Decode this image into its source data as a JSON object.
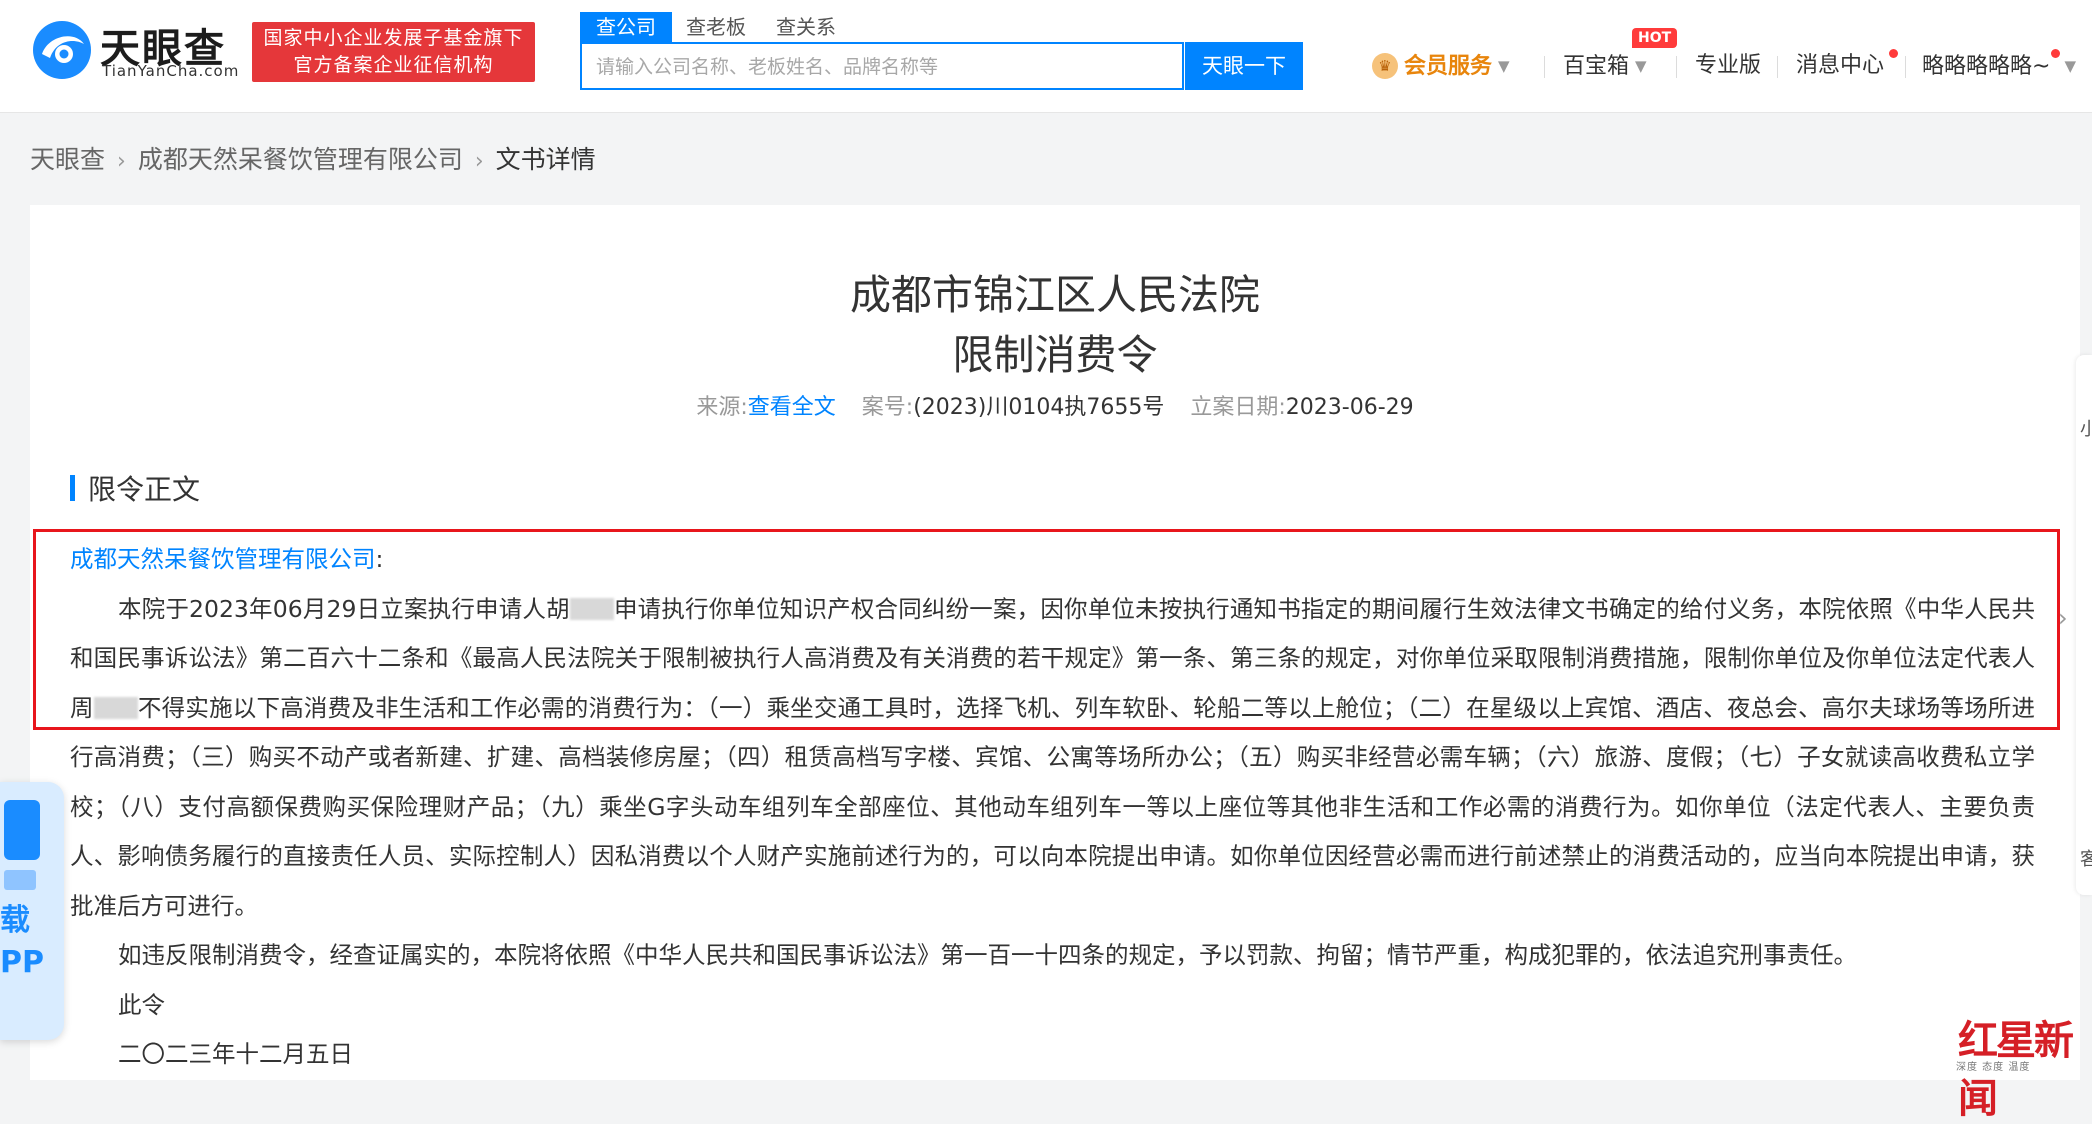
{
  "header": {
    "logo_cn": "天眼查",
    "logo_en": "TianYanCha.com",
    "gov_badge_line1": "国家中小企业发展子基金旗下",
    "gov_badge_line2": "官方备案企业征信机构",
    "search_tabs": [
      "查公司",
      "查老板",
      "查关系"
    ],
    "search_placeholder": "请输入公司名称、老板姓名、品牌名称等",
    "search_button": "天眼一下",
    "nav": {
      "vip": "会员服务",
      "treasure": "百宝箱",
      "hot": "HOT",
      "pro": "专业版",
      "messages": "消息中心",
      "user": "略略略略略~"
    }
  },
  "breadcrumb": {
    "home": "天眼查",
    "company": "成都天然呆餐饮管理有限公司",
    "current": "文书详情"
  },
  "document": {
    "court": "成都市锦江区人民法院",
    "title": "限制消费令",
    "source_label": "来源:",
    "source_link": "查看全文",
    "case_label": "案号:",
    "case_no": "(2023)川0104执7655号",
    "date_label": "立案日期:",
    "date": "2023-06-29",
    "section_title": "限令正文",
    "addressee": "成都天然呆餐饮管理有限公司",
    "addressee_suffix": ":",
    "p1_a": "本院于2023年06月29日立案执行申请人胡",
    "p1_b": "申请执行你单位知识产权合同纠纷一案，因你单位未按执行通知书指定的期间履行生效法律文书确定的给付义务，本院依照《中华人民共和国民事诉讼法》第二百六十二条和《最高人民法院关于限制被执行人高消费及有关消费的若干规定》第一条、第三条的规定，对你单位采取限制消费措施，限制你单位及你单位法定代表人周",
    "p1_c": "不得实施以下高消费及非生活和工作必需的消费行为：（一）乘坐交通工具时，选择飞机、列车软卧、轮船二等以上舱位；（二）在星级以上宾馆、酒店、夜总会、高尔夫球场等场所进行高消费；（三）购买不动产或者新建、扩建、高档装修房屋；（四）租赁高档写字楼、宾馆、公寓等场所办公；（五）购买非经营必需车辆；（六）旅游、度假；（七）子女就读高收费私立学校；（八）支付高额保费购买保险理财产品；（九）乘坐G字头动车组列车全部座位、其他动车组列车一等以上座位等其他非生活和工作必需的消费行为。如你单位（法定代表人、主要负责人、影响债务履行的直接责任人员、实际控制人）因私消费以个人财产实施前述行为的，可以向本院提出申请。如你单位因经营必需而进行前述禁止的消费活动的，应当向本院提出申请，获批准后方可进行。",
    "p2": "如违反限制消费令，经查证属实的，本院将依照《中华人民共和国民事诉讼法》第一百一十四条的规定，予以罚款、拘留；情节严重，构成犯罪的，依法追究刑事责任。",
    "p3": "此令",
    "p4": "二〇二三年十二月五日"
  },
  "float": {
    "app_text": "载\nPP",
    "right_chars": [
      "小",
      "客"
    ]
  },
  "watermark": {
    "main": "红星新闻",
    "sub": "深度 态度 温度"
  },
  "colors": {
    "brand_blue": "#0084ff",
    "badge_red": "#e5373a",
    "highlight_red": "#e8161c",
    "vip_orange": "#e8850c"
  }
}
